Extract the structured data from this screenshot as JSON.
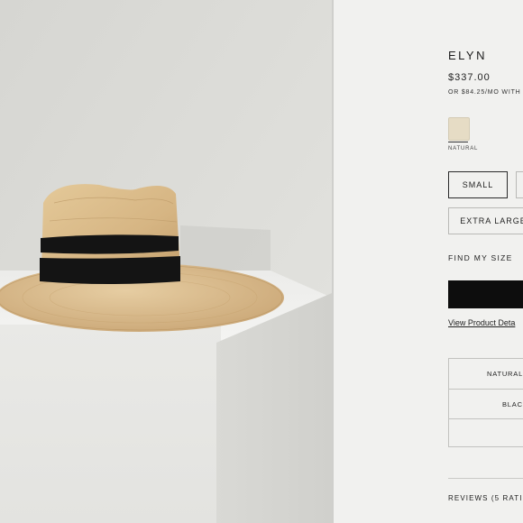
{
  "product": {
    "title": "ELYN",
    "price": "$337.00",
    "installment": "OR $84.25/MO WITH"
  },
  "color": {
    "selected_label": "NATURAL",
    "swatch_color": "#e6dcc5"
  },
  "sizes": {
    "options": [
      {
        "label": "SMALL",
        "selected": true
      },
      {
        "label": "",
        "selected": false
      },
      {
        "label": "EXTRA LARGE",
        "selected": false
      }
    ]
  },
  "find_my_size": "FIND MY SIZE",
  "view_details": "View Product Deta",
  "variants": [
    "NATURAL",
    "BLAC",
    ""
  ],
  "reviews": "REVIEWS (5 RATI",
  "colors": {
    "cart_button": "#0d0d0d",
    "hat_band": "#141414",
    "straw": "#d8b98a"
  }
}
